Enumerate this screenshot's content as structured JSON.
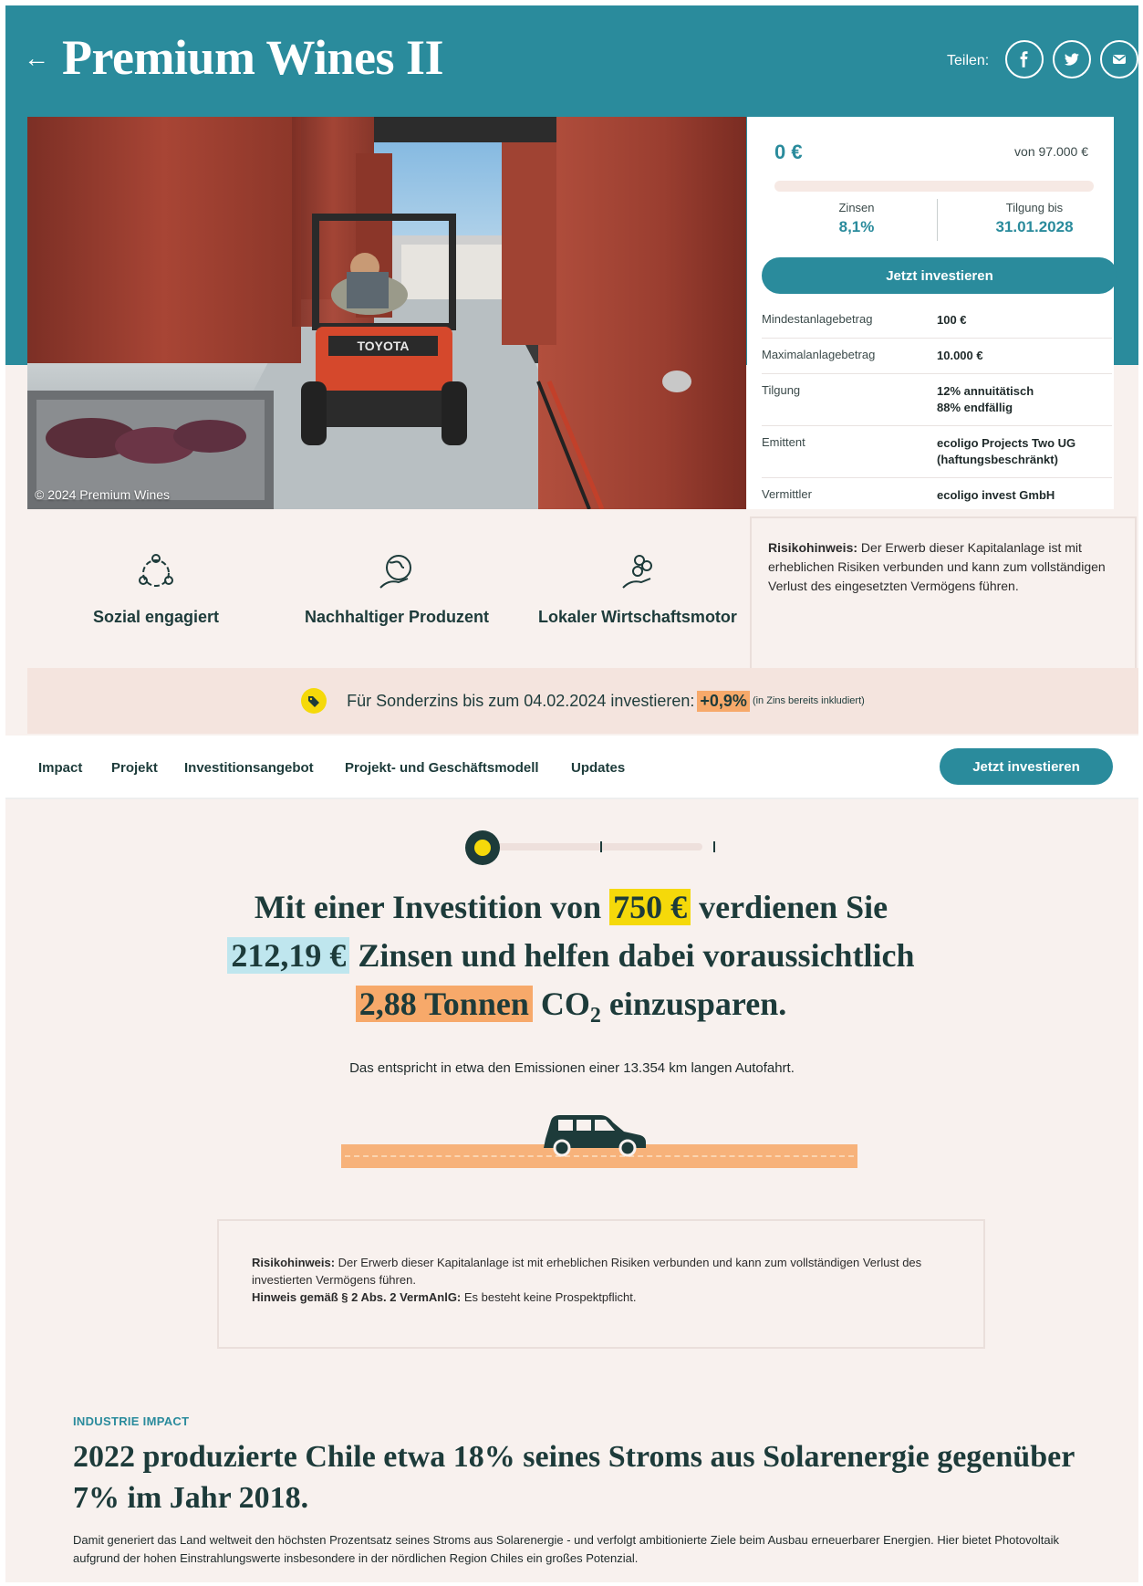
{
  "header": {
    "back_icon": "arrow-left-icon",
    "title": "Premium Wines II",
    "share_label": "Teilen:",
    "share_icons": [
      "facebook-icon",
      "twitter-icon",
      "mail-icon"
    ]
  },
  "photo": {
    "caption": "© 2024 Premium Wines"
  },
  "investment": {
    "raised": "0 €",
    "goal": "von 97.000 €",
    "progress_fraction": 0.0,
    "interest_label": "Zinsen",
    "interest_value": "8,1%",
    "repayment_label": "Tilgung bis",
    "repayment_value": "31.01.2028",
    "cta": "Jetzt investieren",
    "details": [
      {
        "key": "Mindestanlagebetrag",
        "value": "100 €"
      },
      {
        "key": "Maximalanlagebetrag",
        "value": "10.000 €"
      },
      {
        "key": "Tilgung",
        "value": "12% annuitätisch\n88% endfällig"
      },
      {
        "key": "Emittent",
        "value": "ecoligo Projects Two UG (haftungsbeschränkt)"
      },
      {
        "key": "Vermittler",
        "value": "ecoligo invest GmbH"
      }
    ]
  },
  "features": [
    {
      "icon": "community-hands-icon",
      "label": "Sozial engagiert"
    },
    {
      "icon": "globe-hand-icon",
      "label": "Nachhaltiger Produzent"
    },
    {
      "icon": "coins-hand-icon",
      "label": "Lokaler Wirtschaftsmotor"
    }
  ],
  "risk_side": {
    "bold": "Risikohinweis:",
    "text": " Der Erwerb dieser Kapitalanlage ist mit erheblichen Risiken verbunden und kann zum vollständigen Verlust des eingesetzten Vermögens führen."
  },
  "promo": {
    "icon": "tag-icon",
    "text_before": "Für Sonderzins bis zum 04.02.2024 investieren:",
    "highlight": "+0,9%",
    "note": "(in Zins bereits inkludiert)"
  },
  "tabs": {
    "items": [
      "Impact",
      "Projekt",
      "Investitionsangebot",
      "Projekt- und Geschäftsmodell",
      "Updates"
    ],
    "cta": "Jetzt investieren"
  },
  "impact": {
    "line1_pre": "Mit einer Investition von",
    "amount": "750 €",
    "line1_post": "verdienen Sie",
    "interest": "212,19 €",
    "line2_post": "Zinsen und helfen dabei voraussichtlich",
    "co2_amount": "2,88 Tonnen",
    "co2_pre": "CO",
    "co2_sub": "2",
    "co2_post": "einzusparen.",
    "equivalent": "Das entspricht in etwa den Emissionen einer 13.354 km langen Autofahrt.",
    "car_icon": "car-icon"
  },
  "risk_bottom": {
    "bold1": "Risikohinweis:",
    "text1": " Der Erwerb dieser Kapitalanlage ist mit erheblichen Risiken verbunden und kann zum vollständigen Verlust des investierten Vermögens führen.",
    "bold2": "Hinweis gemäß § 2 Abs. 2 VermAnlG:",
    "text2": " Es besteht keine Prospektpflicht."
  },
  "industry": {
    "kicker": "INDUSTRIE IMPACT",
    "title": "2022 produzierte Chile etwa 18% seines Stroms aus Solarenergie gegenüber 7% im Jahr 2018.",
    "body": "Damit generiert das Land weltweit den höchsten Prozentsatz seines Stroms aus Solarenergie - und verfolgt ambitionierte Ziele beim Ausbau erneuerbarer Energien. Hier bietet Photovoltaik aufgrund der hohen Einstrahlungswerte insbesondere in der nördlichen Region Chiles ein großes Potenzial."
  },
  "colors": {
    "teal": "#2a8b9c",
    "dark_green": "#1d3b3a",
    "highlight_yellow": "#f5d90a",
    "highlight_blue": "#bfe6ee",
    "highlight_orange": "#f7a96a",
    "background": "#f8f1ee"
  }
}
